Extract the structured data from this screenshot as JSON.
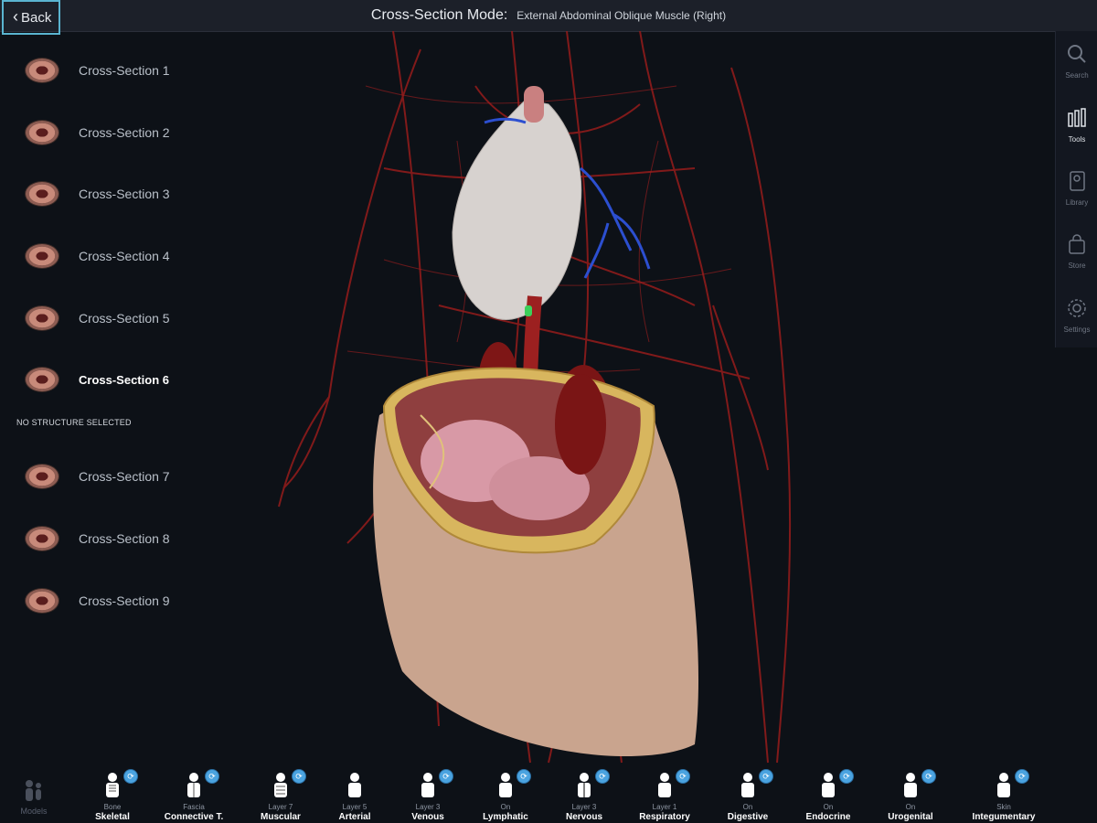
{
  "header": {
    "back_label": "Back",
    "title": "Cross-Section Mode:",
    "subtitle": "External Abdominal Oblique Muscle (Right)"
  },
  "cross_sections": [
    {
      "label": "Cross-Section 1",
      "active": false
    },
    {
      "label": "Cross-Section 2",
      "active": false
    },
    {
      "label": "Cross-Section 3",
      "active": false
    },
    {
      "label": "Cross-Section 4",
      "active": false
    },
    {
      "label": "Cross-Section 5",
      "active": false
    },
    {
      "label": "Cross-Section 6",
      "active": true
    },
    {
      "label": "Cross-Section 7",
      "active": false
    },
    {
      "label": "Cross-Section 8",
      "active": false
    },
    {
      "label": "Cross-Section 9",
      "active": false
    }
  ],
  "selection_status": "NO STRUCTURE SELECTED",
  "right_toolbar": [
    {
      "label": "Search",
      "icon": "search-icon",
      "active": false
    },
    {
      "label": "Tools",
      "icon": "tools-icon",
      "active": true
    },
    {
      "label": "Library",
      "icon": "library-icon",
      "active": false
    },
    {
      "label": "Store",
      "icon": "store-icon",
      "active": false
    },
    {
      "label": "Settings",
      "icon": "settings-icon",
      "active": false
    }
  ],
  "bottom": {
    "models_label": "Models",
    "systems": [
      {
        "sub": "Bone",
        "name": "Skeletal"
      },
      {
        "sub": "Fascia",
        "name": "Connective T."
      },
      {
        "sub": "Layer 7",
        "name": "Muscular"
      },
      {
        "sub": "Layer 5",
        "name": "Arterial"
      },
      {
        "sub": "Layer 3",
        "name": "Venous"
      },
      {
        "sub": "On",
        "name": "Lymphatic"
      },
      {
        "sub": "Layer 3",
        "name": "Nervous"
      },
      {
        "sub": "Layer 1",
        "name": "Respiratory"
      },
      {
        "sub": "On",
        "name": "Digestive"
      },
      {
        "sub": "On",
        "name": "Endocrine"
      },
      {
        "sub": "On",
        "name": "Urogenital"
      },
      {
        "sub": "Skin",
        "name": "Integumentary"
      }
    ]
  },
  "colors": {
    "accent": "#4aa3e0",
    "back_outline": "#5ab4d0",
    "artery": "#8e1b1b",
    "vein": "#2c4fd0"
  }
}
